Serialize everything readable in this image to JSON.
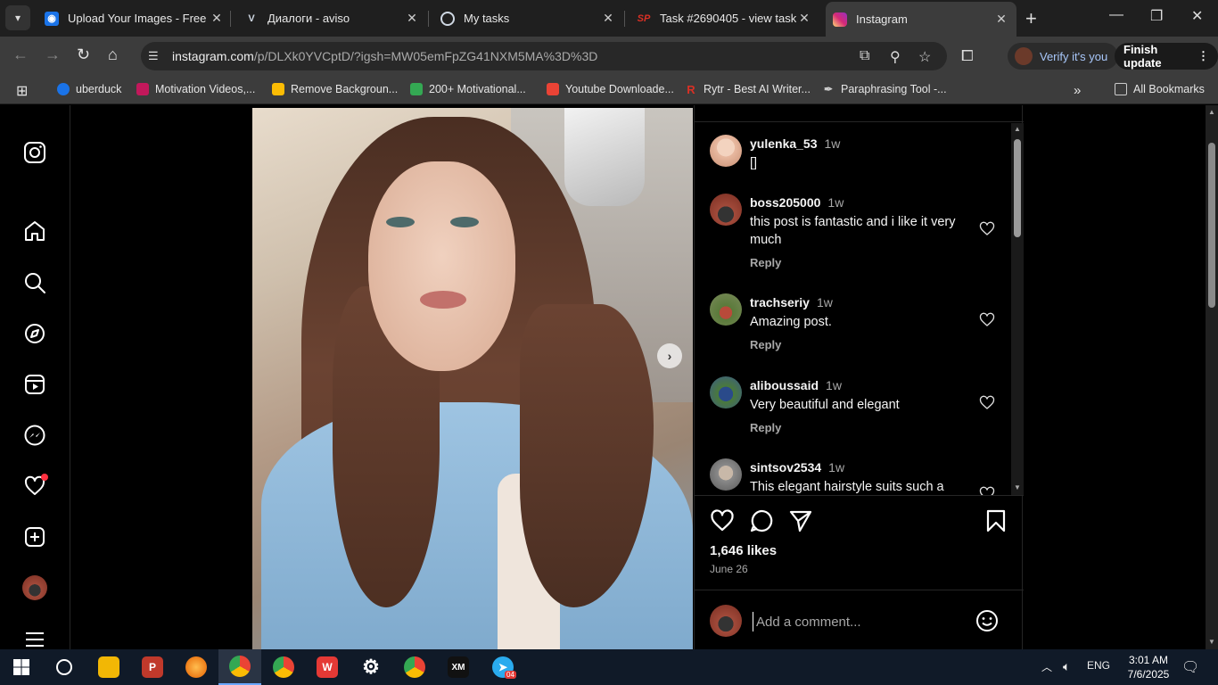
{
  "browser": {
    "tabs": [
      {
        "title": "Upload Your Images - Free I",
        "icon": "upload-icon",
        "color": "#1a73e8"
      },
      {
        "title": "Диалоги - aviso",
        "icon": "aviso-icon",
        "color": "#cfd8e3"
      },
      {
        "title": "My tasks",
        "icon": "tasks-icon",
        "color": "#cfd8e3"
      },
      {
        "title": "Task #2690405 - view task",
        "icon": "sp-icon",
        "color": "#d93025"
      },
      {
        "title": "Instagram",
        "icon": "instagram-icon",
        "color": "#e1306c"
      }
    ],
    "url_domain": "instagram.com",
    "url_path": "/p/DLXk0YVCptD/?igsh=MW05emFpZG41NXM5MA%3D%3D",
    "verify_label": "Verify it's you",
    "finish_update_label": "Finish update",
    "bookmarks": [
      {
        "label": "uberduck",
        "color": "#1a73e8"
      },
      {
        "label": "Motivation Videos,...",
        "color": "#c2185b"
      },
      {
        "label": "Remove Backgroun...",
        "color": "#fbbc04"
      },
      {
        "label": "200+ Motivational...",
        "color": "#34a853"
      },
      {
        "label": "Youtube Downloade...",
        "color": "#ea4335"
      },
      {
        "label": "Rytr - Best AI Writer...",
        "color": "#d93025"
      },
      {
        "label": "Paraphrasing Tool -...",
        "color": "#888888"
      }
    ],
    "all_bookmarks_label": "All Bookmarks"
  },
  "post": {
    "comments": [
      {
        "user": "yulenka_53",
        "time": "1w",
        "text": "[]",
        "has_reply": false,
        "avatar_color": "#e8b9a0"
      },
      {
        "user": "boss205000",
        "time": "1w",
        "text": "this post is fantastic and i like it very much",
        "has_reply": true,
        "avatar_color": "#a24a3a"
      },
      {
        "user": "trachseriy",
        "time": "1w",
        "text": "Amazing post.",
        "has_reply": true,
        "avatar_color": "#5a7a3a"
      },
      {
        "user": "aliboussaid",
        "time": "1w",
        "text": "Very beautiful and elegant",
        "has_reply": true,
        "avatar_color": "#3a5a8a"
      },
      {
        "user": "sintsov2534",
        "time": "1w",
        "text": "This elegant hairstyle suits such a",
        "has_reply": false,
        "avatar_color": "#8a8a8a"
      }
    ],
    "reply_label": "Reply",
    "likes": "1,646 likes",
    "date": "June 26",
    "comment_placeholder": "Add a comment..."
  },
  "taskbar": {
    "language": "ENG",
    "time": "3:01 AM",
    "date": "7/6/2025",
    "telegram_badge": "04"
  }
}
